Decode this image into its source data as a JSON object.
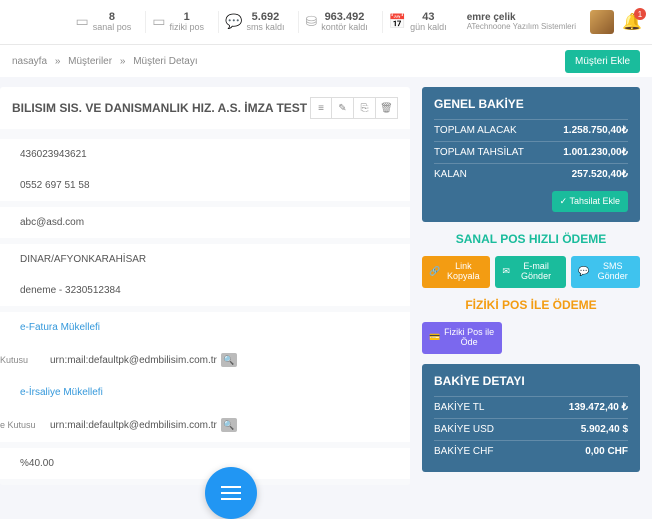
{
  "topbar": {
    "stats": [
      {
        "value": "8",
        "label": "sanal pos"
      },
      {
        "value": "1",
        "label": "fiziki pos"
      },
      {
        "value": "5.692",
        "label": "sms kaldı"
      },
      {
        "value": "963.492",
        "label": "kontör kaldı"
      },
      {
        "value": "43",
        "label": "gün kaldı"
      }
    ],
    "user": {
      "name": "emre çelik",
      "sub": "ATechnoone Yazılım Sistemleri"
    },
    "notif_count": "1"
  },
  "breadcrumb": {
    "a": "nasayfa",
    "b": "Müşteriler",
    "c": "Müşteri Detayı",
    "add_btn": "Müşteri Ekle"
  },
  "customer": {
    "title": "BILISIM SIS. VE DANISMANLIK HIZ. A.S. İMZA TEST",
    "vkn": "436023943621",
    "phone": "0552 697 51 58",
    "email": "abc@asd.com",
    "city": "DINAR/AFYONKARAHİSAR",
    "note": "deneme - 3230512384",
    "efatura_label": "e-Fatura Mükellefi",
    "efatura_urn": "urn:mail:defaultpk@edmbilisim.com.tr",
    "eirsaliye_label": "e-İrsaliye Mükellefi",
    "eirsaliye_urn": "urn:mail:defaultpk@edmbilisim.com.tr",
    "kutusu": "Kutusu",
    "ekutusu": "e Kutusu",
    "rate": "%40.00"
  },
  "balance": {
    "title": "GENEL BAKİYE",
    "rows": [
      {
        "label": "TOPLAM ALACAK",
        "value": "1.258.750,40₺"
      },
      {
        "label": "TOPLAM TAHSİLAT",
        "value": "1.001.230,00₺"
      },
      {
        "label": "KALAN",
        "value": "257.520,40₺"
      }
    ],
    "add_btn": "Tahsilat Ekle"
  },
  "sanal_pos": {
    "title": "SANAL POS HIZLI ÖDEME",
    "link": "Link Kopyala",
    "email": "E-mail Gönder",
    "sms": "SMS Gönder"
  },
  "fiziki_pos": {
    "title": "FİZİKİ POS İLE ÖDEME",
    "btn": "Fiziki Pos ile Öde"
  },
  "detail": {
    "title": "BAKİYE DETAYI",
    "rows": [
      {
        "label": "BAKİYE TL",
        "value": "139.472,40 ₺"
      },
      {
        "label": "BAKİYE USD",
        "value": "5.902,40 $"
      },
      {
        "label": "BAKİYE CHF",
        "value": "0,00 CHF"
      }
    ]
  }
}
